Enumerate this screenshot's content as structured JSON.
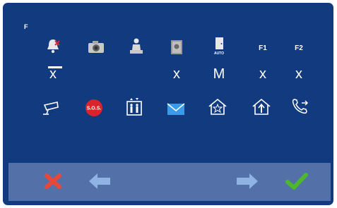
{
  "header": {
    "function_key": "F"
  },
  "functions": [
    {
      "name": "mute-bell",
      "icon": "bell-mute-icon",
      "value": "x",
      "selected": true
    },
    {
      "name": "camera",
      "icon": "camera-icon",
      "value": ""
    },
    {
      "name": "doorman",
      "icon": "doorman-icon",
      "value": ""
    },
    {
      "name": "photo-memory",
      "icon": "photo-icon",
      "value": "x"
    },
    {
      "name": "auto-door",
      "icon": "auto-door-icon",
      "label": "AUTO",
      "value": "M"
    },
    {
      "name": "f1",
      "label": "F1",
      "value": "x"
    },
    {
      "name": "f2",
      "label": "F2",
      "value": "x"
    }
  ],
  "row2_icons": [
    "cctv-camera-icon",
    "sos-icon",
    "elevator-icon",
    "mail-icon",
    "home-alarm-icon",
    "home-call-icon",
    "call-transfer-icon"
  ],
  "sos_label": "S.O.S.",
  "toolbar": [
    "cancel-icon",
    "left-arrow-icon",
    "right-arrow-icon",
    "confirm-icon"
  ],
  "colors": {
    "background": "#123a7e",
    "toolbar": "#5470a8",
    "sos": "#d9242b",
    "cancel": "#e8483a",
    "confirm": "#4db82a",
    "arrows": "#8fb3e2"
  }
}
